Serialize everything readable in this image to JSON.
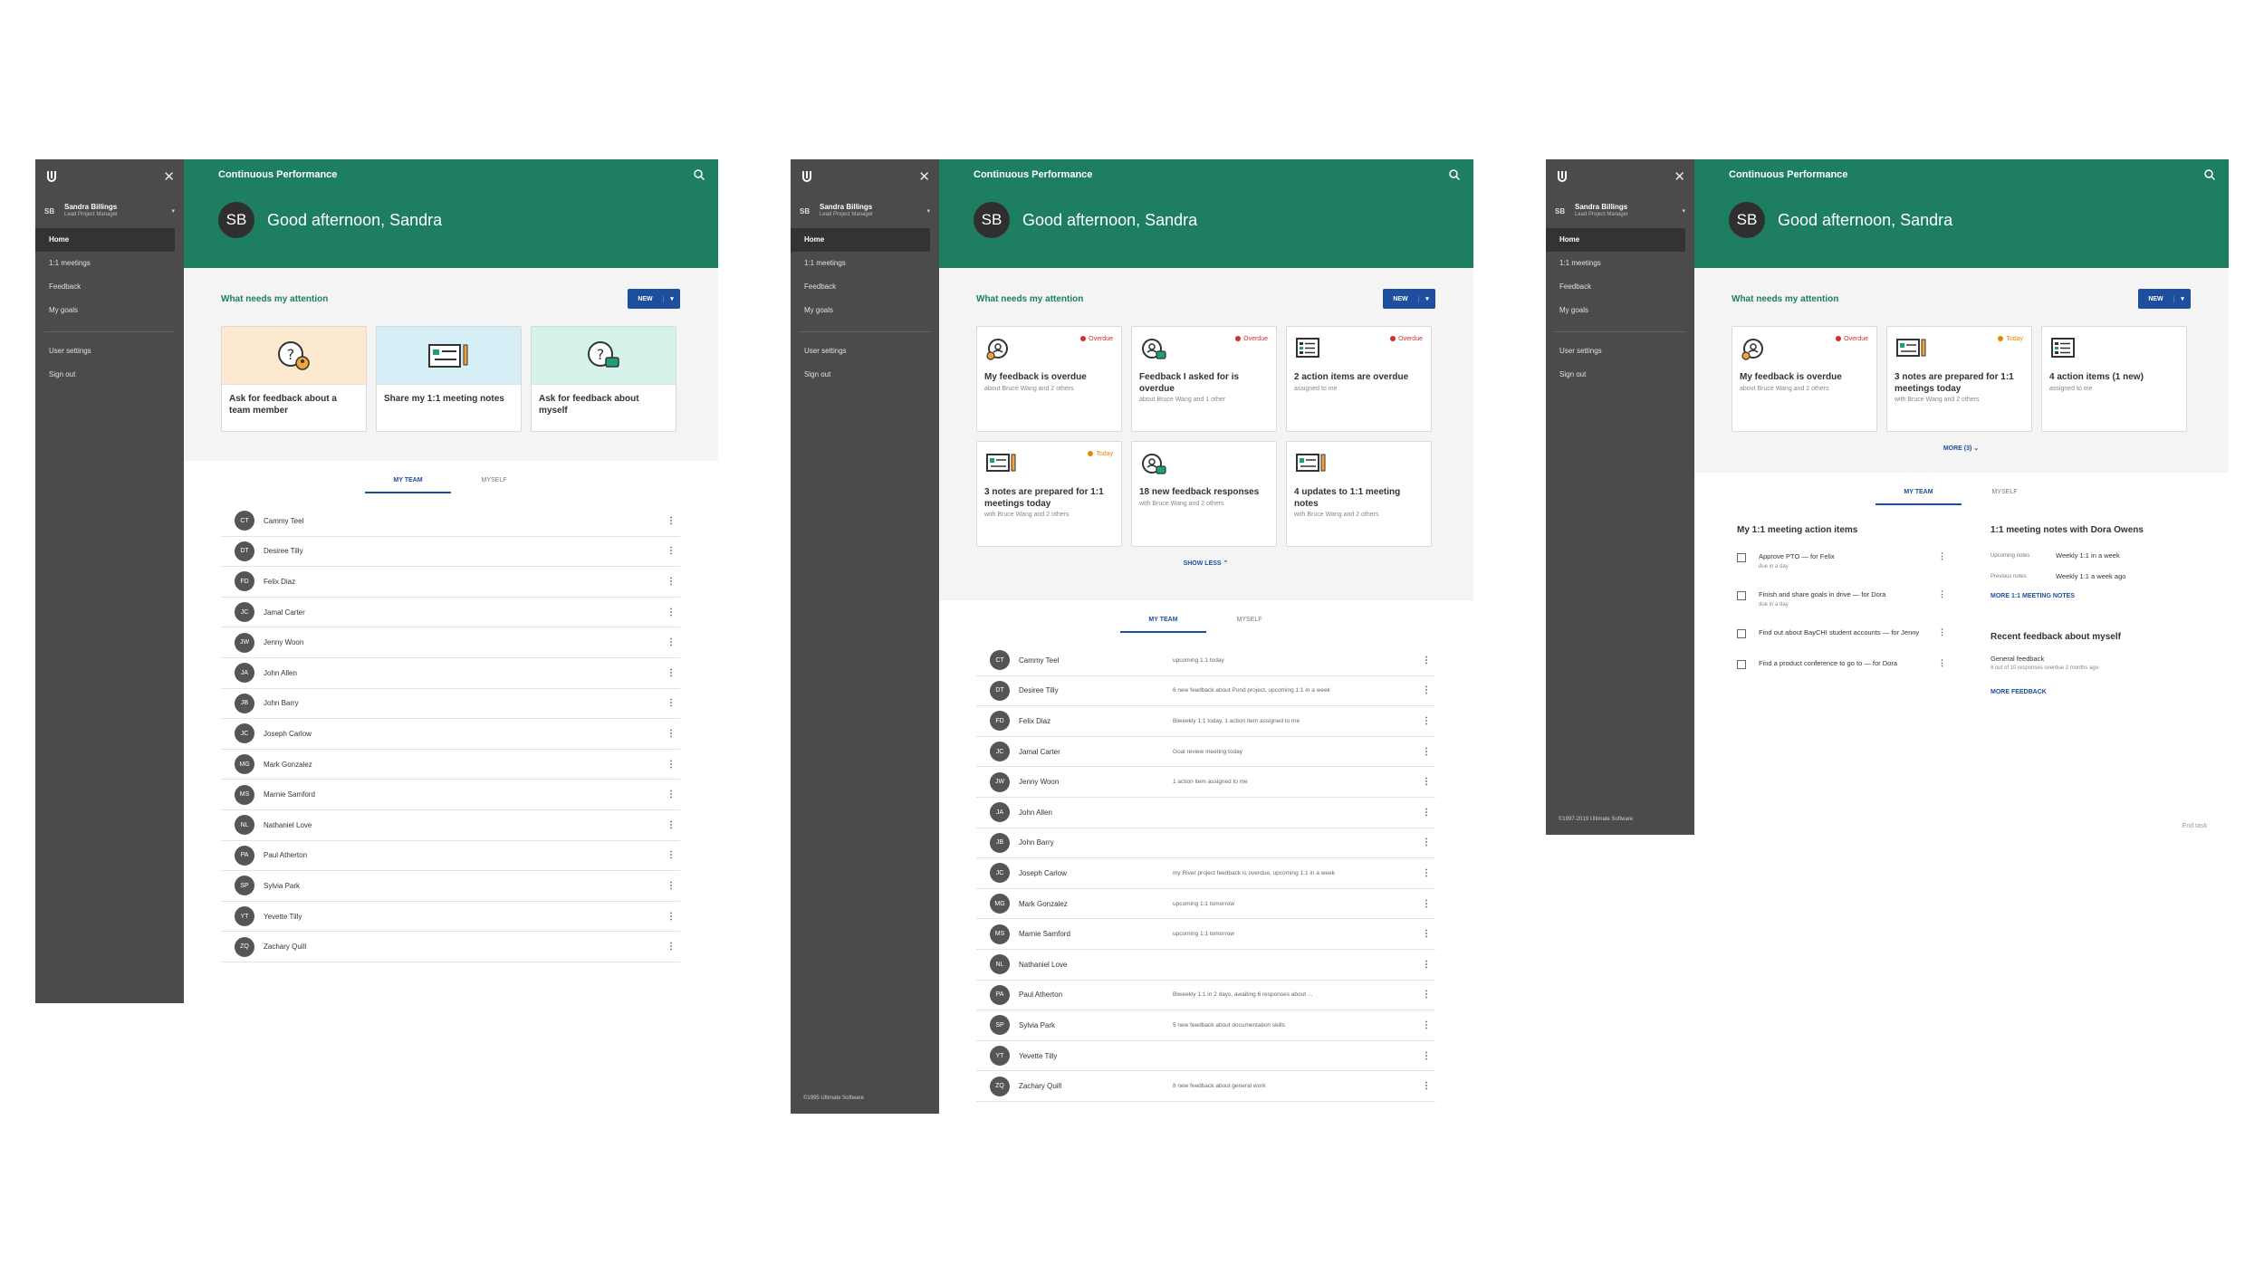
{
  "common": {
    "sidebar": {
      "user_initials": "SB",
      "user_name": "Sandra Billings",
      "user_role": "Lead Project Manager",
      "nav": [
        "Home",
        "1:1 meetings",
        "Feedback",
        "My goals"
      ],
      "nav2": [
        "User settings",
        "Sign out"
      ]
    },
    "header": {
      "app_title": "Continuous Performance",
      "greeting_initials": "SB",
      "greeting": "Good afternoon, Sandra"
    },
    "attention_title": "What needs my attention",
    "new_button": "NEW",
    "tabs": [
      "MY TEAM",
      "MYSELF"
    ],
    "colors": {
      "primary_green": "#1e7e61",
      "sidebar_bg": "#4b4b4b",
      "accent_blue": "#1d4f9e",
      "overdue_red": "#d32f2f",
      "today_orange": "#e38a00"
    }
  },
  "screen1": {
    "cards": [
      {
        "title": "Ask for feedback about a team member",
        "icon": "feedback-person-icon",
        "bg": "#fde9cf"
      },
      {
        "title": "Share my 1:1 meeting notes",
        "icon": "notes-icon",
        "bg": "#d6eef5"
      },
      {
        "title": "Ask for feedback about myself",
        "icon": "feedback-chat-icon",
        "bg": "#d5f3ea"
      }
    ],
    "team": [
      {
        "initials": "CT",
        "name": "Cammy Teel"
      },
      {
        "initials": "DT",
        "name": "Desiree Tilly"
      },
      {
        "initials": "FD",
        "name": "Felix Diaz"
      },
      {
        "initials": "JC",
        "name": "Jamal Carter"
      },
      {
        "initials": "JW",
        "name": "Jenny Woon"
      },
      {
        "initials": "JA",
        "name": "John Allen"
      },
      {
        "initials": "JB",
        "name": "John Barry"
      },
      {
        "initials": "JC",
        "name": "Joseph Carlow"
      },
      {
        "initials": "MG",
        "name": "Mark Gonzalez"
      },
      {
        "initials": "MS",
        "name": "Marnie Samford"
      },
      {
        "initials": "NL",
        "name": "Nathaniel Love"
      },
      {
        "initials": "PA",
        "name": "Paul Atherton"
      },
      {
        "initials": "SP",
        "name": "Sylvia Park"
      },
      {
        "initials": "YT",
        "name": "Yevette Tilly"
      },
      {
        "initials": "ZQ",
        "name": "Zachary Quill"
      }
    ]
  },
  "screen2": {
    "cards": [
      {
        "status": "Overdue",
        "title": "My feedback is overdue",
        "sub": "about Bruce Wang and 2 others",
        "icon": "feedback-icon"
      },
      {
        "status": "Overdue",
        "title": "Feedback I asked for is overdue",
        "sub": "about Bruce Wang and 1 other",
        "icon": "feedback-request-icon"
      },
      {
        "status": "Overdue",
        "title": "2 action items are overdue",
        "sub": "assigned to me",
        "icon": "checklist-icon"
      },
      {
        "status": "Today",
        "title": "3 notes are prepared for 1:1 meetings today",
        "sub": "with Bruce Wang and 2 others",
        "icon": "notes-icon"
      },
      {
        "status": "",
        "title": "18 new feedback responses",
        "sub": "with Bruce Wang and 2 others",
        "icon": "feedback-request-icon"
      },
      {
        "status": "",
        "title": "4 updates to 1:1 meeting notes",
        "sub": "with Bruce Wang and 2 others",
        "icon": "notes-icon"
      }
    ],
    "show_less": "SHOW LESS",
    "copyright": "©1995 Ultimate Software",
    "team": [
      {
        "initials": "CT",
        "name": "Cammy Teel",
        "status": "upcoming 1:1 today"
      },
      {
        "initials": "DT",
        "name": "Desiree Tilly",
        "status": "6 new feedback about Pond project, upcoming 1:1 in a week"
      },
      {
        "initials": "FD",
        "name": "Felix Diaz",
        "status": "Biweekly 1:1 today, 1 action item assigned to me"
      },
      {
        "initials": "JC",
        "name": "Jamal Carter",
        "status": "Goal review meeting today"
      },
      {
        "initials": "JW",
        "name": "Jenny Woon",
        "status": "1 action item assigned to me"
      },
      {
        "initials": "JA",
        "name": "John Allen",
        "status": ""
      },
      {
        "initials": "JB",
        "name": "John Barry",
        "status": ""
      },
      {
        "initials": "JC",
        "name": "Joseph Carlow",
        "status": "my River project feedback is overdue, upcoming 1:1 in a week"
      },
      {
        "initials": "MG",
        "name": "Mark Gonzalez",
        "status": "upcoming 1:1 tomorrow"
      },
      {
        "initials": "MS",
        "name": "Marnie Samford",
        "status": "upcoming 1:1 tomorrow"
      },
      {
        "initials": "NL",
        "name": "Nathaniel Love",
        "status": ""
      },
      {
        "initials": "PA",
        "name": "Paul Atherton",
        "status": "Biweekly 1:1 in 2 days, awaiting 6 responses about ..."
      },
      {
        "initials": "SP",
        "name": "Sylvia Park",
        "status": "5 new feedback about documentation skills"
      },
      {
        "initials": "YT",
        "name": "Yevette Tilly",
        "status": ""
      },
      {
        "initials": "ZQ",
        "name": "Zachary Quill",
        "status": "8 new feedback about general work"
      }
    ]
  },
  "screen3": {
    "cards": [
      {
        "status": "Overdue",
        "title": "My feedback is overdue",
        "sub": "about Bruce Wang and 2 others",
        "icon": "feedback-icon"
      },
      {
        "status": "Today",
        "title": "3 notes are prepared for 1:1 meetings today",
        "sub": "with Bruce Wang and 2 others",
        "icon": "notes-icon"
      },
      {
        "status": "",
        "title": "4 action items (1 new)",
        "sub": "assigned to me",
        "icon": "checklist-icon"
      }
    ],
    "more": "MORE (3)",
    "copyright": "©1997-2019 Ultimate Software",
    "end_task": "End task",
    "action_items_title": "My 1:1 meeting action items",
    "action_items": [
      {
        "text": "Approve PTO — for Felix",
        "due": "due in a day"
      },
      {
        "text": "Finish and share goals in drive — for Dora",
        "due": "due in a day"
      },
      {
        "text": "Find out about BayCHI student accounts — for Jenny",
        "due": ""
      },
      {
        "text": "Find a product conference to go to — for Dora",
        "due": ""
      }
    ],
    "notes_title": "1:1 meeting notes with Dora Owens",
    "notes": [
      {
        "label": "Upcoming notes",
        "value": "Weekly 1:1 in a week"
      },
      {
        "label": "Previous notes",
        "value": "Weekly 1:1 a week ago"
      }
    ],
    "more_notes": "MORE 1:1 MEETING NOTES",
    "recent_title": "Recent feedback about myself",
    "recent_item": "General feedback",
    "recent_sub": "6 out of 10 responses overdue 2 months ago",
    "more_feedback": "MORE FEEDBACK"
  }
}
